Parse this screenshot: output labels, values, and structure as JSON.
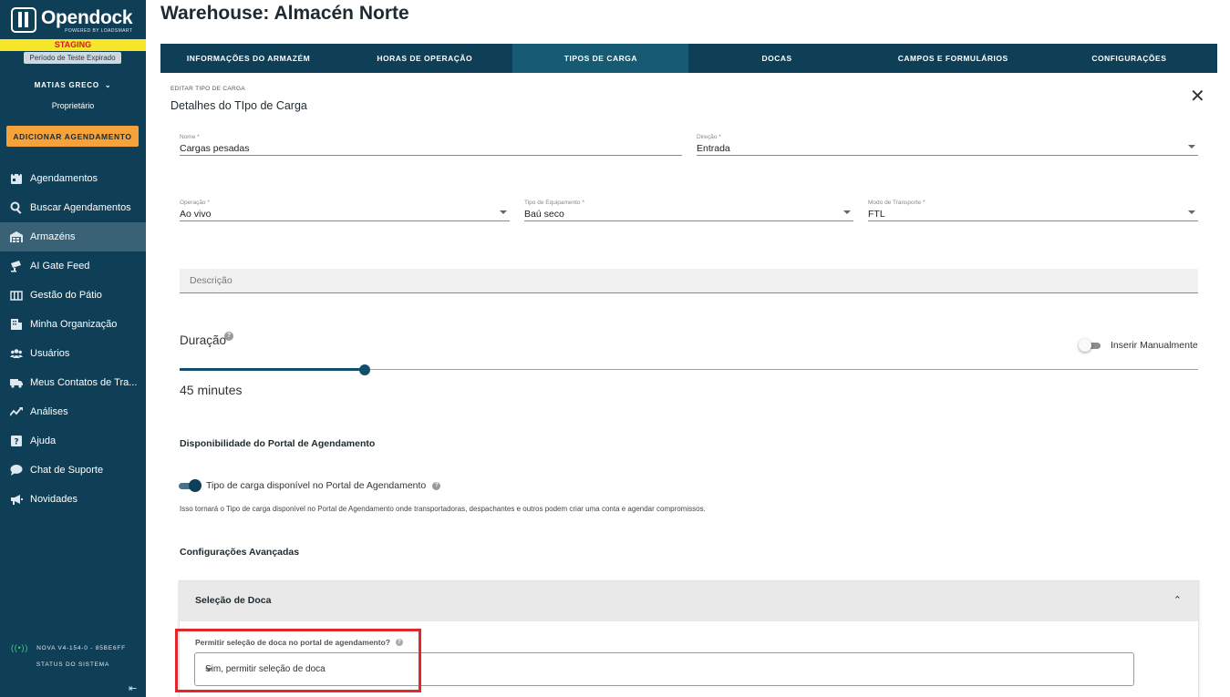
{
  "brand": {
    "name": "Opendock",
    "tagline": "POWERED BY LOADSMART",
    "staging": "STAGING",
    "trial": "Período de Teste Expirado"
  },
  "user": {
    "name": "MATIAS GRECO",
    "role": "Proprietário"
  },
  "sidebar": {
    "add_button": "ADICIONAR AGENDAMENTO",
    "items": [
      {
        "label": "Agendamentos",
        "icon": "calendar-icon"
      },
      {
        "label": "Buscar Agendamentos",
        "icon": "search-icon"
      },
      {
        "label": "Armazéns",
        "icon": "warehouse-icon",
        "active": true
      },
      {
        "label": "AI Gate Feed",
        "icon": "camera-icon"
      },
      {
        "label": "Gestão do Pátio",
        "icon": "yard-icon"
      },
      {
        "label": "Minha Organização",
        "icon": "building-icon"
      },
      {
        "label": "Usuários",
        "icon": "users-icon"
      },
      {
        "label": "Meus Contatos de Tra...",
        "icon": "truck-icon"
      },
      {
        "label": "Análises",
        "icon": "chart-icon"
      },
      {
        "label": "Ajuda",
        "icon": "help-icon"
      },
      {
        "label": "Chat de Suporte",
        "icon": "chat-icon"
      },
      {
        "label": "Novidades",
        "icon": "megaphone-icon"
      }
    ],
    "version": "NOVA V4-154-0 - 85BE6FF",
    "system_status": "STATUS DO SISTEMA"
  },
  "page": {
    "title": "Warehouse: Almacén Norte"
  },
  "tabs": [
    {
      "label": "INFORMAÇÕES DO ARMAZÉM"
    },
    {
      "label": "HORAS DE OPERAÇÃO"
    },
    {
      "label": "TIPOS DE CARGA",
      "active": true
    },
    {
      "label": "DOCAS"
    },
    {
      "label": "CAMPOS E FORMULÁRIOS"
    },
    {
      "label": "CONFIGURAÇÕES"
    }
  ],
  "form": {
    "overline": "EDITAR TIPO DE CARGA",
    "title": "Detalhes do TIpo de Carga",
    "name": {
      "label": "Nome *",
      "value": "Cargas pesadas"
    },
    "direction": {
      "label": "Direção *",
      "value": "Entrada"
    },
    "operation": {
      "label": "Operação *",
      "value": "Ao vivo"
    },
    "equipment": {
      "label": "Tipo de Equipamento *",
      "value": "Baú seco"
    },
    "transport": {
      "label": "Modo de Transporte *",
      "value": "FTL"
    },
    "description": {
      "placeholder": "Descrição"
    },
    "duration": {
      "label": "Duração",
      "value_text": "45 minutes",
      "slider_fraction": 0.182,
      "manual_label": "Inserir Manualmente",
      "manual_enabled": false
    },
    "availability": {
      "heading": "Disponibilidade do Portal de Agendamento",
      "toggle_label": "Tipo de carga disponível no Portal de Agendamento",
      "toggle_enabled": true,
      "note": "Isso tornará o Tipo de carga disponível no Portal de Agendamento onde transportadoras, despachantes e outros podem criar uma conta e agendar compromissos."
    },
    "advanced": {
      "heading": "Configurações Avançadas",
      "panel_title": "Seleção de Doca",
      "dock_question": "Permitir seleção de doca no portal de agendamento?",
      "dock_value": "Sim, permitir seleção de doca"
    }
  },
  "colors": {
    "sidebar_bg": "#0f3f57",
    "accent": "#f5a23a",
    "staging_bg": "#f7e62a",
    "highlight": "#e0272b"
  }
}
